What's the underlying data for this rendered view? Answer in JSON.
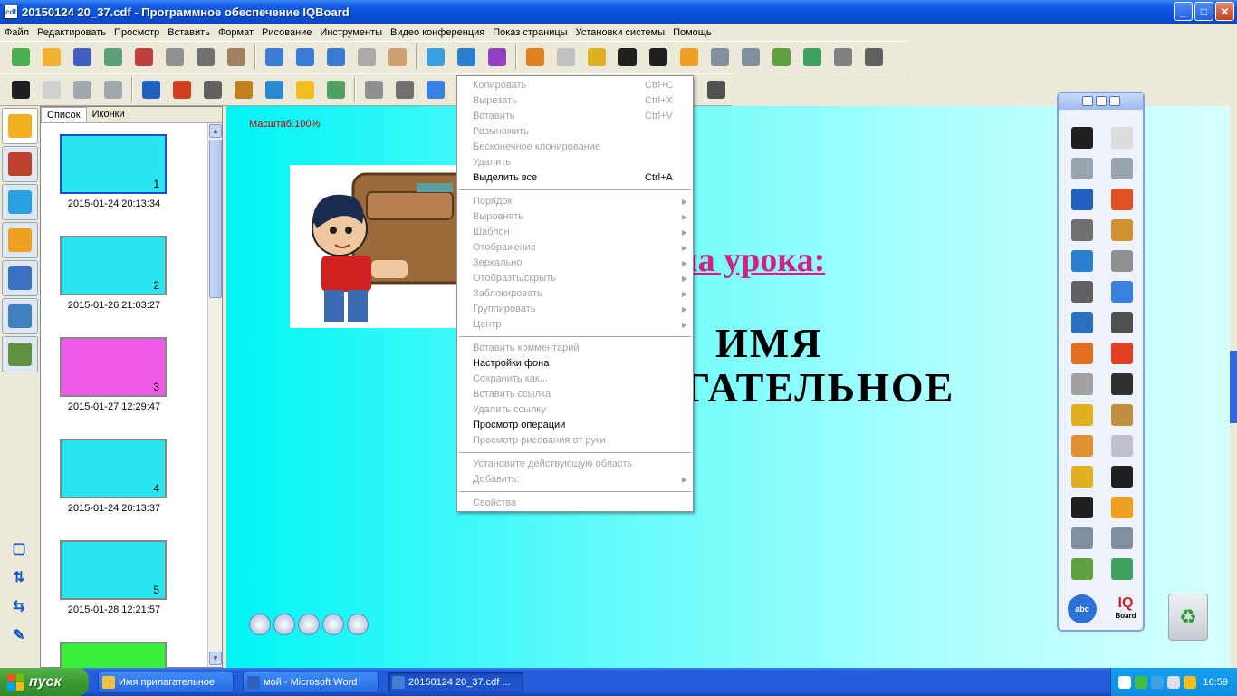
{
  "window": {
    "title": "20150124 20_37.cdf - Программное обеспечение IQBoard",
    "app_icon_text": "cdf"
  },
  "menubar": [
    "Файл",
    "Редактировать",
    "Просмотр",
    "Вставить",
    "Формат",
    "Рисование",
    "Инструменты",
    "Видео конференция",
    "Показ страницы",
    "Установки системы",
    "Помощь"
  ],
  "toolbar1": {
    "groups": [
      [
        {
          "icon": "new-page-icon",
          "color": "#4caf50"
        },
        {
          "icon": "open-icon",
          "color": "#f0b030"
        },
        {
          "icon": "save-icon",
          "color": "#4060c0"
        },
        {
          "icon": "save-as-icon",
          "color": "#5aa07a"
        },
        {
          "icon": "delete-page-icon",
          "color": "#c04040"
        },
        {
          "icon": "copy-icon",
          "color": "#909090"
        },
        {
          "icon": "cut-icon",
          "color": "#707070"
        },
        {
          "icon": "paste-icon",
          "color": "#a08060"
        }
      ],
      [
        {
          "icon": "zoom-in-icon",
          "color": "#3a7bd5"
        },
        {
          "icon": "zoom-out-icon",
          "color": "#3a7bd5"
        },
        {
          "icon": "zoom-icon",
          "color": "#3a7bd5"
        },
        {
          "icon": "fit-icon",
          "color": "#aaaaaa"
        },
        {
          "icon": "hand-icon",
          "color": "#d0a070"
        }
      ],
      [
        {
          "icon": "background-icon",
          "color": "#3aa0e0"
        },
        {
          "icon": "fullscreen-icon",
          "color": "#2a80d0"
        },
        {
          "icon": "dual-pen-icon",
          "color": "#9040c0"
        }
      ],
      [
        {
          "icon": "pointer-tool-icon",
          "color": "#e08020"
        },
        {
          "icon": "spotlight-icon",
          "color": "#c0c0c0"
        },
        {
          "icon": "screen-capture-icon",
          "color": "#e0b020"
        },
        {
          "icon": "comment-icon",
          "color": "#202020"
        },
        {
          "icon": "screen-icon",
          "color": "#202020"
        },
        {
          "icon": "back-arrow-icon",
          "color": "#f0a020"
        },
        {
          "icon": "camera-icon",
          "color": "#8090a0"
        },
        {
          "icon": "video-camera-icon",
          "color": "#8090a0"
        },
        {
          "icon": "backpack-icon",
          "color": "#60a040"
        },
        {
          "icon": "eraser-cart-icon",
          "color": "#40a060"
        },
        {
          "icon": "record-icon",
          "color": "#808080"
        },
        {
          "icon": "grid-icon",
          "color": "#606060"
        }
      ]
    ]
  },
  "toolbar2": {
    "tools": [
      {
        "icon": "select-arrow-icon",
        "color": "#202020"
      },
      {
        "icon": "mouse-icon",
        "color": "#d0d0d0"
      },
      {
        "icon": "undo-icon",
        "color": "#a0a8b0"
      },
      {
        "icon": "redo-icon",
        "color": "#a0a8b0"
      },
      {
        "icon": "pen-icon",
        "color": "#2060c0"
      },
      {
        "icon": "red-pen-icon",
        "color": "#d04020"
      },
      {
        "icon": "brush-icon",
        "color": "#606060"
      },
      {
        "icon": "highlighter-icon",
        "color": "#c08020"
      },
      {
        "icon": "texture-pen-icon",
        "color": "#2a8ad0"
      },
      {
        "icon": "laser-pen-icon",
        "color": "#f0c020"
      },
      {
        "icon": "magic-pen-icon",
        "color": "#50a060"
      },
      {
        "icon": "eraser-icon",
        "color": "#909090"
      },
      {
        "icon": "line-icon",
        "color": "#707070"
      },
      {
        "icon": "pentagon-icon",
        "color": "#3a80e0"
      }
    ],
    "end_icon": "format-icon"
  },
  "left_tabs": [
    {
      "icon": "page-list-icon",
      "color": "#f0b020",
      "active": true
    },
    {
      "icon": "library-icon",
      "color": "#c04030",
      "active": false
    },
    {
      "icon": "background-gallery-icon",
      "color": "#2aa0e0",
      "active": false
    },
    {
      "icon": "folders-icon",
      "color": "#f0a020",
      "active": false
    },
    {
      "icon": "tools-icon",
      "color": "#3a70c0",
      "active": false
    },
    {
      "icon": "resources-icon",
      "color": "#4080c0",
      "active": false
    },
    {
      "icon": "notes-icon",
      "color": "#609040",
      "active": false
    }
  ],
  "left_small_icons": [
    "frame-icon",
    "swap-vertical-icon",
    "swap-horizontal-icon",
    "pin-icon"
  ],
  "slide_panel": {
    "tabs": [
      "Список",
      "Иконки"
    ],
    "slides": [
      {
        "number": "1",
        "date": "2015-01-24 20:13:34",
        "bg": "#28e5f0",
        "selected": true
      },
      {
        "number": "2",
        "date": "2015-01-26 21:03:27",
        "bg": "#28e5f0",
        "selected": false
      },
      {
        "number": "3",
        "date": "2015-01-27 12:29:47",
        "bg": "#ef5ae8",
        "selected": false
      },
      {
        "number": "4",
        "date": "2015-01-24 20:13:37",
        "bg": "#28e5f0",
        "selected": false
      },
      {
        "number": "5",
        "date": "2015-01-28 12:21:57",
        "bg": "#28e5f0",
        "selected": false
      }
    ]
  },
  "canvas": {
    "scale": "Масштаб:100%",
    "heading1": "ма урока:",
    "heading2": "ИМЯ",
    "heading3": "АГАТЕЛЬНОЕ"
  },
  "context_menu": {
    "groups": [
      [
        {
          "label": "Копировать",
          "shortcut": "Ctrl+C",
          "enabled": false
        },
        {
          "label": "Вырезать",
          "shortcut": "Ctrl+X",
          "enabled": false
        },
        {
          "label": "Вставить",
          "shortcut": "Ctrl+V",
          "enabled": false
        },
        {
          "label": "Размножить",
          "shortcut": "",
          "enabled": false
        },
        {
          "label": "Бесконечное клонирование",
          "shortcut": "",
          "enabled": false
        },
        {
          "label": "Удалить",
          "shortcut": "",
          "enabled": false
        },
        {
          "label": "Выделить все",
          "shortcut": "Ctrl+A",
          "enabled": true
        }
      ],
      [
        {
          "label": "Порядок",
          "submenu": true,
          "enabled": false
        },
        {
          "label": "Выровнять",
          "submenu": true,
          "enabled": false
        },
        {
          "label": "Шаблон",
          "submenu": true,
          "enabled": false
        },
        {
          "label": "Отображение",
          "submenu": true,
          "enabled": false
        },
        {
          "label": "Зеркально",
          "submenu": true,
          "enabled": false
        },
        {
          "label": "Отобразть/скрыть",
          "submenu": true,
          "enabled": false
        },
        {
          "label": "Заблокировать",
          "submenu": true,
          "enabled": false
        },
        {
          "label": "Группировать",
          "submenu": true,
          "enabled": false
        },
        {
          "label": "Центр",
          "submenu": true,
          "enabled": false
        }
      ],
      [
        {
          "label": "Вставить комментарий",
          "enabled": false
        },
        {
          "label": "Настройки фона",
          "enabled": true
        },
        {
          "label": "Сохранить как...",
          "enabled": false
        },
        {
          "label": "Вставить ссылка",
          "enabled": false
        },
        {
          "label": "Удалить ссылку",
          "enabled": false
        },
        {
          "label": "Просмотр операции",
          "enabled": true
        },
        {
          "label": "Просмотр рисования от руки",
          "enabled": false
        }
      ],
      [
        {
          "label": "Установите действующую область",
          "enabled": false
        },
        {
          "label": "Добавить:",
          "submenu": true,
          "enabled": false
        }
      ],
      [
        {
          "label": "Свойства",
          "enabled": false
        }
      ]
    ]
  },
  "palette": {
    "tools": [
      {
        "icon": "select-arrow-icon",
        "color": "#202020"
      },
      {
        "icon": "mouse-icon",
        "color": "#dddddd"
      },
      {
        "icon": "undo-icon",
        "color": "#9aa4b0"
      },
      {
        "icon": "redo-icon",
        "color": "#9aa4b0"
      },
      {
        "icon": "pen-icon",
        "color": "#2060c0"
      },
      {
        "icon": "red-pen-icon",
        "color": "#e05020"
      },
      {
        "icon": "brush-icon",
        "color": "#707070"
      },
      {
        "icon": "highlighter-icon",
        "color": "#d09030"
      },
      {
        "icon": "texture-pen-icon",
        "color": "#2a80d0"
      },
      {
        "icon": "eraser-icon",
        "color": "#909090"
      },
      {
        "icon": "line-icon",
        "color": "#606060"
      },
      {
        "icon": "pentagon-icon",
        "color": "#3a80e0"
      },
      {
        "icon": "line-chart-icon",
        "color": "#2a70c0"
      },
      {
        "icon": "triangle-icon",
        "color": "#505050"
      },
      {
        "icon": "pie-chart-icon",
        "color": "#e07020"
      },
      {
        "icon": "bar-chart-icon",
        "color": "#e04020"
      },
      {
        "icon": "table-icon",
        "color": "#a0a0a0"
      },
      {
        "icon": "text-icon",
        "color": "#303030"
      },
      {
        "icon": "fill-icon",
        "color": "#e0b020"
      },
      {
        "icon": "ruler-icon",
        "color": "#c09040"
      },
      {
        "icon": "pointer-tool-icon",
        "color": "#e09030"
      },
      {
        "icon": "spotlight-icon",
        "color": "#c0c0d0"
      },
      {
        "icon": "screen-capture-icon",
        "color": "#e0b020"
      },
      {
        "icon": "comment-icon",
        "color": "#202020"
      },
      {
        "icon": "screen-icon",
        "color": "#202020"
      },
      {
        "icon": "back-arrow-icon",
        "color": "#f0a020"
      },
      {
        "icon": "video-camera-icon",
        "color": "#8090a0"
      },
      {
        "icon": "camera-icon",
        "color": "#8090a0"
      },
      {
        "icon": "backpack-icon",
        "color": "#60a040"
      },
      {
        "icon": "eraser-cart-icon",
        "color": "#40a060"
      }
    ],
    "abc_label": "abc",
    "brand_text": "IQ",
    "brand_sub": "Board"
  },
  "taskbar": {
    "start_label": "пуск",
    "items": [
      {
        "label": "Имя прилагательное",
        "icon_color": "#f0c040",
        "active": false
      },
      {
        "label": "мой - Microsoft Word",
        "icon_color": "#3060c0",
        "active": false
      },
      {
        "label": "20150124 20_37.cdf ...",
        "icon_color": "#4080d0",
        "active": true
      }
    ],
    "tray_icons": [
      {
        "icon": "arrow-icon",
        "color": "#ffffff"
      },
      {
        "icon": "network-icon",
        "color": "#40c040"
      },
      {
        "icon": "shield-icon",
        "color": "#40a0e0"
      },
      {
        "icon": "speaker-icon",
        "color": "#e0e0e0"
      },
      {
        "icon": "warning-icon",
        "color": "#f0c020"
      }
    ],
    "clock": "16:59"
  },
  "window_buttons": {
    "minimize": "_",
    "maximize": "□",
    "close": "✕"
  }
}
